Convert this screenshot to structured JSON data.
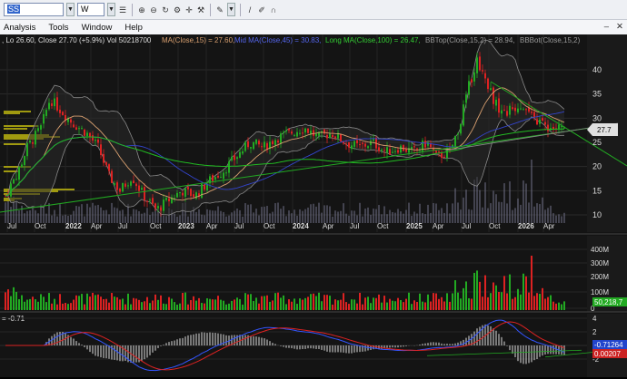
{
  "toolbar": {
    "symbol": "SS",
    "interval": "W",
    "icons": [
      "dropdown-icon",
      "list-icon",
      "zoom-in-icon",
      "zoom-out-icon",
      "refresh-icon",
      "settings-icon",
      "crosshair-icon",
      "draw-tool-icon",
      "pencil-icon",
      "brush-icon",
      "magnet-icon"
    ]
  },
  "menu": {
    "items": [
      "Analysis",
      "Tools",
      "Window",
      "Help"
    ]
  },
  "header": {
    "text": ", Lo 26.60, Close 27.70 (+5.9%) Vol 50218700",
    "ma_label": "MA(Close,15) = 27.60,",
    "mid_ma_label": "Mid MA(Close,45) = 30.83,",
    "long_ma_label": "Long MA(Close,100) = 26.47,",
    "bbtop_label": "BBTop(Close,15,2) = 28.94,",
    "bbbot_label": "BBBot(Close,15,2)"
  },
  "price_axis": {
    "ticks": [
      "40",
      "35",
      "30",
      "25",
      "20",
      "15",
      "10"
    ],
    "current": "27.7"
  },
  "volume_axis": {
    "ticks": [
      "400M",
      "300M",
      "200M",
      "100M",
      "0"
    ],
    "current": "50,218,7"
  },
  "osc": {
    "label": "= -0.71",
    "ticks": [
      "4",
      "2",
      "-2"
    ],
    "value1": "-0.71264",
    "value2": "0.00207"
  },
  "time_axis": {
    "labels": [
      "Jul",
      "Oct",
      "2022",
      "Apr",
      "Jul",
      "Oct",
      "2023",
      "Apr",
      "Jul",
      "Oct",
      "2024",
      "Apr",
      "Jul",
      "Oct",
      "2025",
      "Apr",
      "Jul",
      "Oct",
      "2026",
      "Apr"
    ]
  },
  "colors": {
    "up": "#22aa22",
    "down": "#dd2222",
    "ma": "#d9a070",
    "mid_ma": "#3344cc",
    "long_ma": "#22bb22",
    "bb": "#8a8a8a",
    "volume_profile": "#a09a10"
  }
}
